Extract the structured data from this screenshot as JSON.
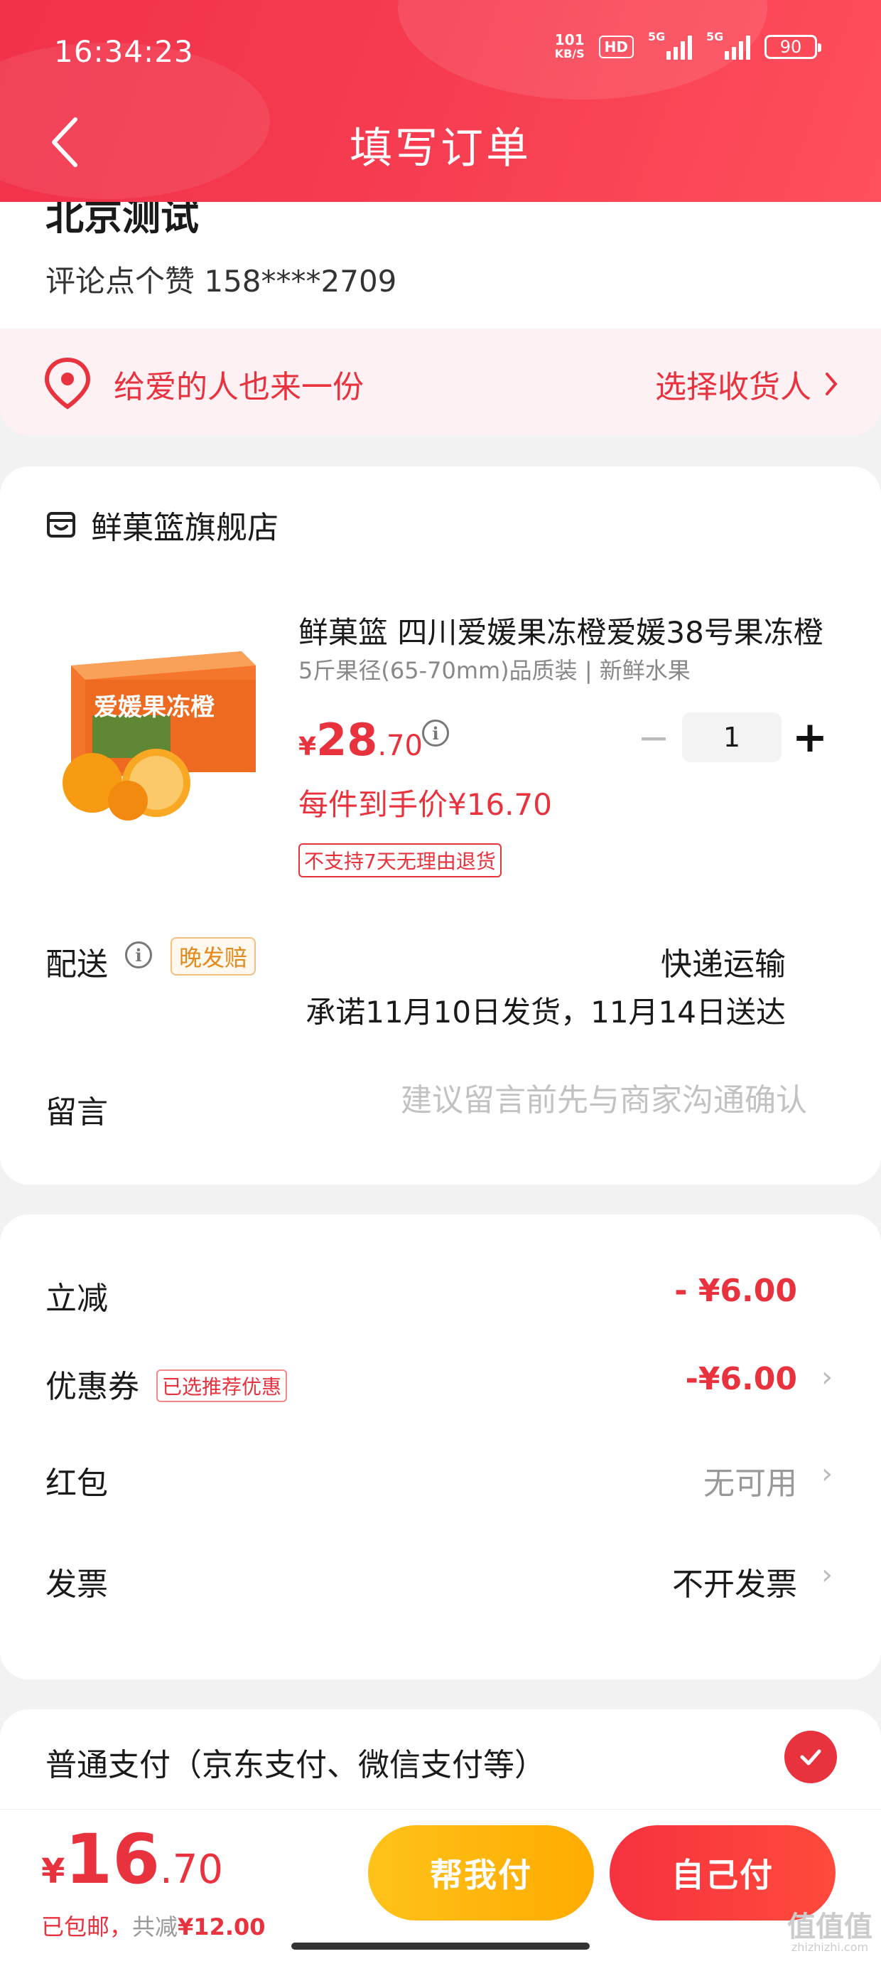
{
  "status_bar": {
    "time": "16:34:23",
    "net_speed_value": "101",
    "net_speed_unit": "KB/S",
    "hd_label": "HD",
    "sim1_label": "5G",
    "sim2_label": "5G",
    "battery": "90"
  },
  "header": {
    "title": "填写订单"
  },
  "address": {
    "name": "北京测试",
    "contact": "评论点个赞  158****2709"
  },
  "gift_bar": {
    "text": "给爱的人也来一份",
    "action": "选择收货人"
  },
  "store": {
    "name": "鲜菓篮旗舰店"
  },
  "product": {
    "title": "鲜菓篮  四川爱媛果冻橙爱媛38号果冻橙",
    "spec": "5斤果径(65-70mm)品质装 | 新鲜水果",
    "price_symbol": "¥",
    "price_int": "28",
    "price_dec": ".70",
    "quantity": "1",
    "unit_price": "每件到手价¥16.70",
    "return_policy": "不支持7天无理由退货",
    "image_caption": "爱媛果冻橙"
  },
  "shipping": {
    "label": "配送",
    "badge": "晚发赔",
    "method": "快递运输",
    "promise": "承诺11月10日发货，11月14日送达"
  },
  "message": {
    "label": "留言",
    "placeholder": "建议留言前先与商家沟通确认"
  },
  "discounts": {
    "instant": {
      "label": "立减",
      "value": "- ¥6.00"
    },
    "coupon": {
      "label": "优惠券",
      "tag": "已选推荐优惠",
      "value": "-¥6.00"
    },
    "red_packet": {
      "label": "红包",
      "value": "无可用"
    },
    "invoice": {
      "label": "发票",
      "value": "不开发票"
    }
  },
  "payment": {
    "label": "普通支付（京东支付、微信支付等）",
    "selected": true
  },
  "bottom": {
    "total_symbol": "¥",
    "total_int": "16",
    "total_dec": ".70",
    "free_shipping": "已包邮，",
    "saved_label": "共减",
    "saved_value": "¥12.00",
    "help_pay": "帮我付",
    "self_pay": "自己付"
  },
  "watermark": {
    "glyphs": "值值值",
    "site": "zhizhizhi.com"
  },
  "colors": {
    "primary_red": "#e8323e",
    "header_red": "#f63b50",
    "help_yellow": "#ffb800",
    "late_orange": "#e38a1c"
  }
}
